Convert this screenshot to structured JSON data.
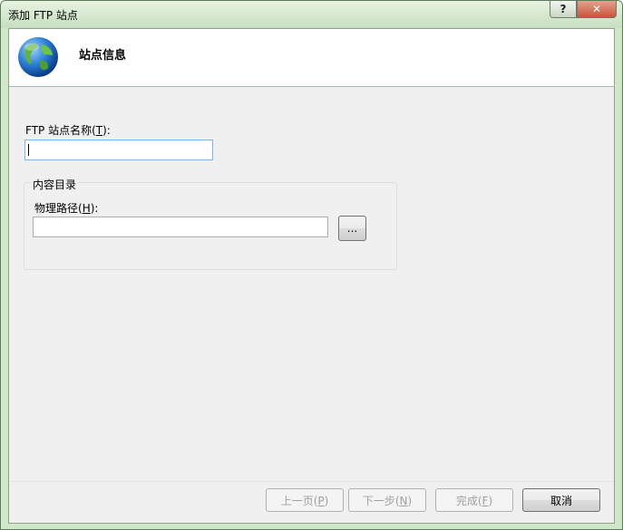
{
  "window": {
    "title": "添加 FTP 站点",
    "help_label": "?",
    "close_label": "✕"
  },
  "header": {
    "title": "站点信息",
    "icon": "globe-icon"
  },
  "form": {
    "site_name_label": "FTP 站点名称(",
    "site_name_key": "T",
    "site_name_suffix": "):",
    "site_name_value": "",
    "content_group_label": "内容目录",
    "physical_path_label": "物理路径(",
    "physical_path_key": "H",
    "physical_path_suffix": "):",
    "physical_path_value": "",
    "browse_label": "..."
  },
  "footer": {
    "prev_label": "上一页(",
    "prev_key": "P",
    "next_label": "下一步(",
    "next_key": "N",
    "finish_label": "完成(",
    "finish_key": "F",
    "close_paren": ")",
    "cancel_label": "取消"
  }
}
